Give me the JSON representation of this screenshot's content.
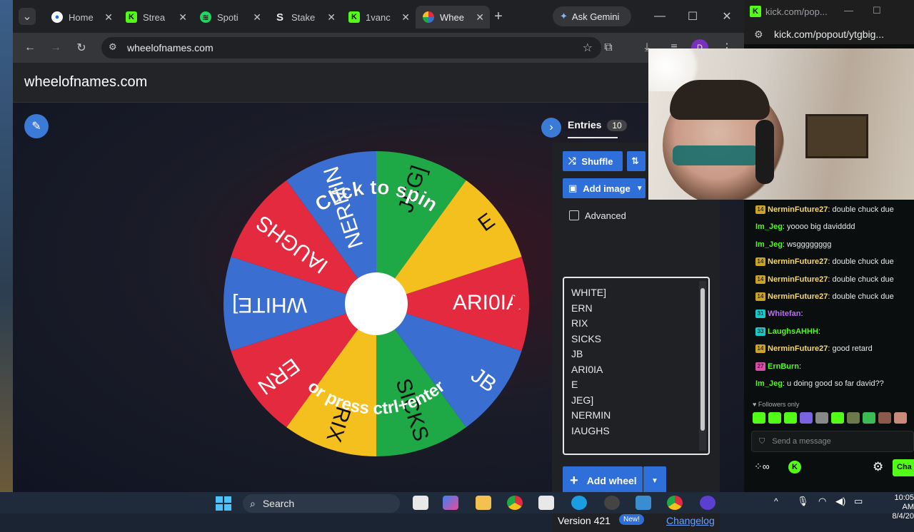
{
  "browser": {
    "tabs": [
      {
        "label": "Home",
        "favicon": "chrome-icon"
      },
      {
        "label": "Strea",
        "favicon": "kick-icon"
      },
      {
        "label": "Spoti",
        "favicon": "spotify-icon"
      },
      {
        "label": "Stake",
        "favicon": "stake-icon"
      },
      {
        "label": "1vanc",
        "favicon": "kick-icon"
      },
      {
        "label": "Whee",
        "favicon": "wheel-icon"
      }
    ],
    "gemini_label": "Ask Gemini",
    "url": "wheelofnames.com",
    "profile_initial": "D"
  },
  "site": {
    "title": "wheelofnames.com"
  },
  "wheel": {
    "click_text": "Click to spin",
    "press_text": "or press ctrl+enter",
    "segments": [
      {
        "label": "ARI0IA",
        "color": "#e32a3f"
      },
      {
        "label": "JB",
        "color": "#3a6ed1"
      },
      {
        "label": "SICKS",
        "color": "#1ea846"
      },
      {
        "label": "RIX",
        "color": "#f4c01e"
      },
      {
        "label": "ERN",
        "color": "#e32a3f"
      },
      {
        "label": "WHITE]",
        "color": "#3a6ed1"
      },
      {
        "label": "IAUGHS",
        "color": "#e32a3f"
      },
      {
        "label": "NERMIN",
        "color": "#3a6ed1"
      },
      {
        "label": "JEG]",
        "color": "#1ea846"
      },
      {
        "label": "E",
        "color": "#f4c01e"
      }
    ],
    "pointer_color": "#e32a3f"
  },
  "panel": {
    "entries_label": "Entries",
    "entries_count": "10",
    "shuffle_label": "Shuffle",
    "add_image_label": "Add image",
    "advanced_label": "Advanced",
    "entries": [
      "WHITE]",
      "ERN",
      "RIX",
      "SICKS",
      "JB",
      "ARI0IA",
      "E",
      "JEG]",
      "NERMIN",
      "IAUGHS"
    ],
    "add_wheel_label": "Add wheel",
    "version_label": "Version 421",
    "new_badge": "New!",
    "changelog_label": "Changelog"
  },
  "kick": {
    "window_title": "kick.com/pop...",
    "url": "kick.com/popout/ytgbig...",
    "messages": [
      {
        "user": "NerminFuture27",
        "text": "double chuck due",
        "color": "#f5d76e",
        "badge": "14"
      },
      {
        "user": "Im_Jeg",
        "text": "yoooo big davidddd",
        "color": "#53fc18",
        "badge": ""
      },
      {
        "user": "Im_Jeg",
        "text": "wsgggggggg",
        "color": "#53fc18",
        "badge": ""
      },
      {
        "user": "NerminFuture27",
        "text": "double chuck due",
        "color": "#f5d76e",
        "badge": "14"
      },
      {
        "user": "NerminFuture27",
        "text": "double chuck due",
        "color": "#f5d76e",
        "badge": "14"
      },
      {
        "user": "NerminFuture27",
        "text": "double chuck due",
        "color": "#f5d76e",
        "badge": "14"
      },
      {
        "user": "Whitefan",
        "text": "",
        "color": "#b96ef0",
        "badge": "31"
      },
      {
        "user": "LaughsAHHH",
        "text": "",
        "color": "#53fc18",
        "badge": "33"
      },
      {
        "user": "NerminFuture27",
        "text": "good retard",
        "color": "#f5d76e",
        "badge": "14"
      },
      {
        "user": "ErnBurn",
        "text": "",
        "color": "#53fc18",
        "badge": "27"
      },
      {
        "user": "Im_Jeg",
        "text": "u doing good so far david??",
        "color": "#53fc18",
        "badge": ""
      }
    ],
    "followers_only": "Followers only",
    "send_placeholder": "Send a message",
    "chat_button": "Cha"
  },
  "taskbar": {
    "search_label": "Search",
    "time": "10:05 AM",
    "date": "8/4/20"
  }
}
